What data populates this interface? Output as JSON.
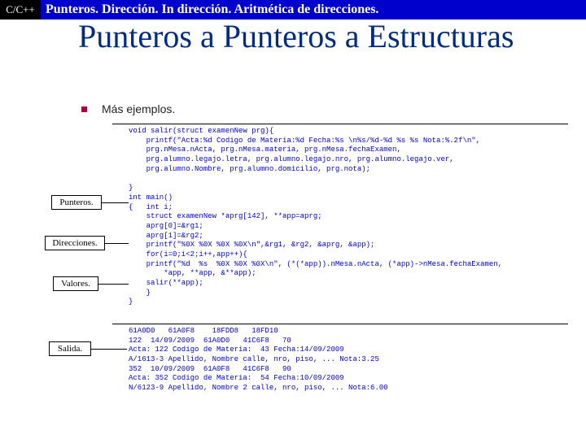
{
  "header": {
    "tag": "C/C++",
    "title": "Punteros. Dirección. In dirección. Aritmética de direcciones."
  },
  "title": "Punteros a Punteros a Estructuras",
  "bullet": "Más ejemplos.",
  "code1": "void salir(struct examenNew prg){\n    printf(\"Acta:%d Codigo de Materia:%d Fecha:%s \\n%s/%d-%d %s %s Nota:%.2f\\n\",\n    prg.nMesa.nActa, prg.nMesa.materia, prg.nMesa.fechaExamen,\n    prg.alumno.legajo.letra, prg.alumno.legajo.nro, prg.alumno.legajo.ver,\n    prg.alumno.Nombre, prg.alumno.domicilio, prg.nota);\n\n}\nint main()\n{   int i;\n    struct examenNew *aprg[142], **app=aprg;\n    aprg[0]=&rg1;\n    aprg[1]=&rg2;\n    printf(\"%0X %0X %0X %0X\\n\",&rg1, &rg2, &aprg, &app);\n    for(i=0;i<2;i++,app++){\n    printf(\"%d  %s  %0X %0X %0X\\n\", (*(*app)).nMesa.nActa, (*app)->nMesa.fechaExamen,\n        *app, **app, &**app);\n    salir(**app);\n    }\n}",
  "code2": "61A0D0   61A0F8    18FDD8   18FD10\n122  14/09/2009  61A0D0   41C6F8   70\nActa: 122 Codigo de Materia:  43 Fecha:14/09/2009\nA/1613-3 Apellido, Nombre calle, nro, piso, ... Nota:3.25\n352  10/09/2009  61A0F8   41C6F8   90\nActa: 352 Codigo de Materia:  54 Fecha:10/09/2009\nN/6123-9 Apellido, Nombre 2 calle, nro, piso, ... Nota:6.00",
  "labels": {
    "punteros": "Punteros.",
    "direcciones": "Direcciones.",
    "valores": "Valores.",
    "salida": "Salida."
  }
}
